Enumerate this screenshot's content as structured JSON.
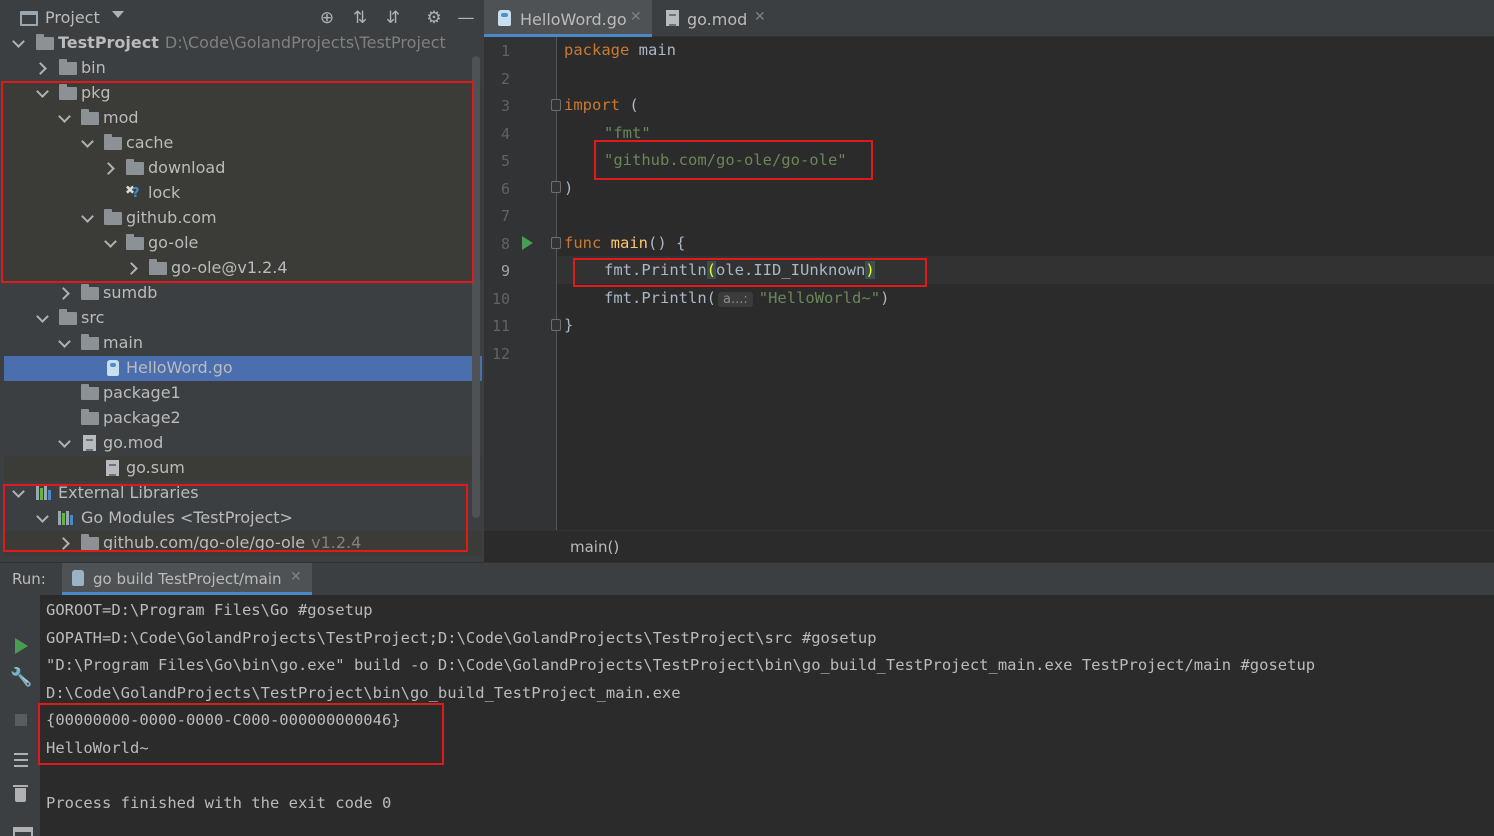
{
  "project_panel": {
    "title": "Project",
    "tree": [
      {
        "label": "TestProject",
        "path": "D:\\Code\\GolandProjects\\TestProject"
      },
      {
        "label": "bin"
      },
      {
        "label": "pkg"
      },
      {
        "label": "mod"
      },
      {
        "label": "cache"
      },
      {
        "label": "download"
      },
      {
        "label": "lock"
      },
      {
        "label": "github.com"
      },
      {
        "label": "go-ole"
      },
      {
        "label": "go-ole@v1.2.4"
      },
      {
        "label": "sumdb"
      },
      {
        "label": "src"
      },
      {
        "label": "main"
      },
      {
        "label": "HelloWord.go"
      },
      {
        "label": "package1"
      },
      {
        "label": "package2"
      },
      {
        "label": "go.mod"
      },
      {
        "label": "go.sum"
      },
      {
        "label": "External Libraries"
      },
      {
        "label": "Go Modules <TestProject>"
      },
      {
        "label": "github.com/go-ole/go-ole",
        "version": "v1.2.4"
      }
    ]
  },
  "editor": {
    "tabs": [
      {
        "label": "HelloWord.go"
      },
      {
        "label": "go.mod"
      }
    ],
    "lines": [
      "1",
      "2",
      "3",
      "4",
      "5",
      "6",
      "7",
      "8",
      "9",
      "10",
      "11",
      "12"
    ],
    "code": {
      "l1_kw": "package",
      "l1_name": " main",
      "l3_kw": "import",
      "l3_rest": " (",
      "l4_str": "\"fmt\"",
      "l5_str": "\"github.com/go-ole/go-ole\"",
      "l6": ")",
      "l8_kw": "func",
      "l8_fn": " main",
      "l8_rest": "() {",
      "l9_pre": "fmt.Println",
      "l9_open": "(",
      "l9_arg": "ole.IID_IUnknown",
      "l9_close": ")",
      "l10_pre": "fmt.Println(",
      "l10_hint": "a...:",
      "l10_str": "\"HelloWorld~\"",
      "l10_close": ")",
      "l11": "}"
    },
    "breadcrumb": "main()"
  },
  "run_panel": {
    "label": "Run:",
    "tab": "go build TestProject/main",
    "output": [
      "GOROOT=D:\\Program Files\\Go #gosetup",
      "GOPATH=D:\\Code\\GolandProjects\\TestProject;D:\\Code\\GolandProjects\\TestProject\\src #gosetup",
      "\"D:\\Program Files\\Go\\bin\\go.exe\" build -o D:\\Code\\GolandProjects\\TestProject\\bin\\go_build_TestProject_main.exe TestProject/main #gosetup",
      "D:\\Code\\GolandProjects\\TestProject\\bin\\go_build_TestProject_main.exe",
      "{00000000-0000-0000-C000-000000000046}",
      "HelloWorld~",
      "",
      "Process finished with the exit code 0"
    ]
  },
  "colors": {
    "annotation": "#e0191b",
    "selection": "#4b6eaf",
    "keyword": "#cc7832",
    "string": "#6a8759",
    "function": "#ffc66d"
  }
}
